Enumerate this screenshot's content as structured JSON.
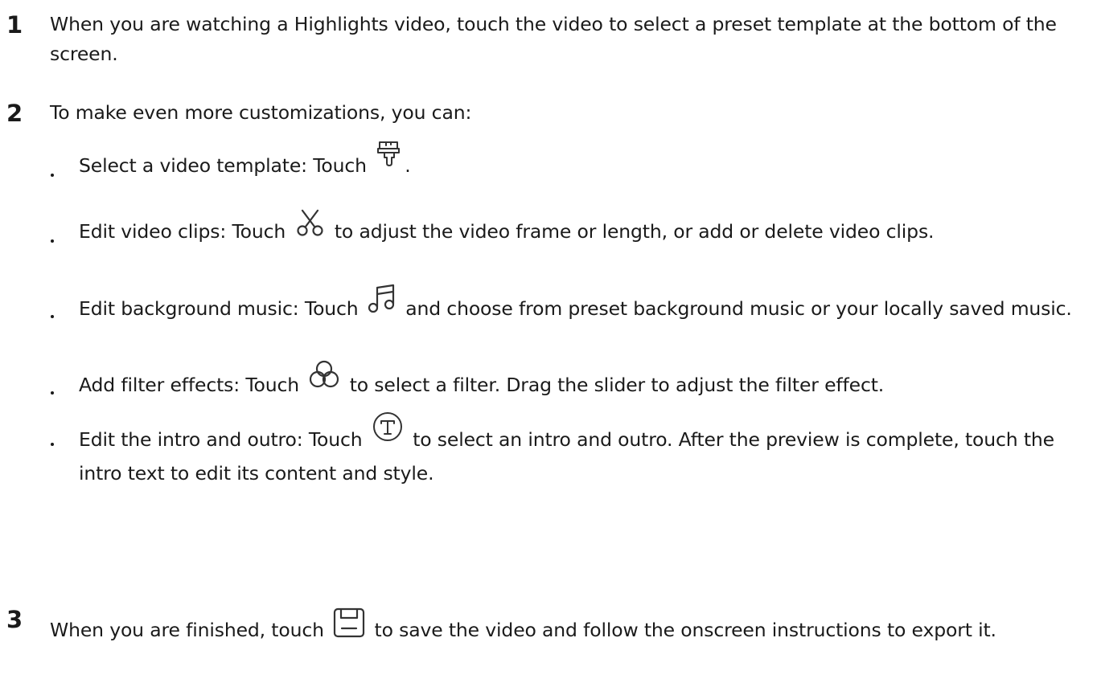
{
  "steps": [
    {
      "number": "1",
      "text": "When you are watching a Highlights video, touch the video to select a preset template at the bottom of the screen."
    },
    {
      "number": "2",
      "text": "To make even more customizations, you can:"
    },
    {
      "number": "3",
      "before": "When you are finished, touch",
      "after": "to save the video and follow the onscreen instructions to export it.",
      "icon": "save-icon"
    }
  ],
  "bullets": [
    {
      "before": "Select a video template: Touch",
      "after": ".",
      "icon": "brush-icon"
    },
    {
      "before": "Edit video clips: Touch",
      "after": "to adjust the video frame or length, or add or delete video clips.",
      "icon": "scissors-icon"
    },
    {
      "before": "Edit background music: Touch",
      "after": "and choose from preset background music or your locally saved music.",
      "icon": "music-note-icon"
    },
    {
      "before": "Add filter effects: Touch",
      "after": "to select a filter. Drag the slider to adjust the filter effect.",
      "icon": "filter-icon"
    },
    {
      "before": "Edit the intro and outro: Touch",
      "after": "to select an intro and outro. After the preview is complete, touch the intro text to edit its content and style.",
      "icon": "text-t-icon"
    }
  ],
  "colors": {
    "text": "#1a1a1a",
    "icon_stroke": "#333333"
  }
}
